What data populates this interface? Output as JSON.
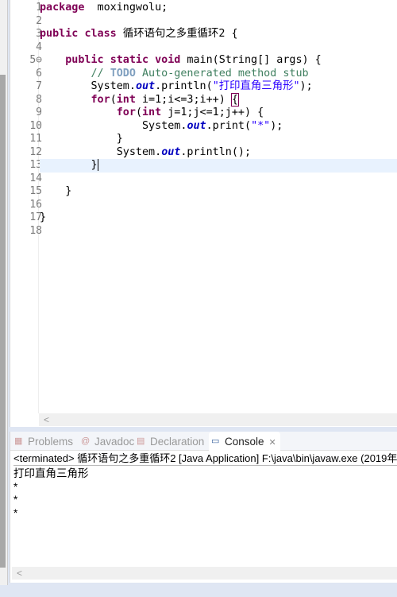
{
  "editor": {
    "lines": [
      [
        [
          "kw",
          "package"
        ],
        [
          "",
          "  moxingwolu;"
        ]
      ],
      [],
      [
        [
          "kw",
          "public"
        ],
        [
          "",
          " "
        ],
        [
          "kw",
          "class"
        ],
        [
          "",
          " 循环语句之多重循环2 {"
        ]
      ],
      [],
      [
        [
          "",
          "    "
        ],
        [
          "kw",
          "public"
        ],
        [
          "",
          " "
        ],
        [
          "kw",
          "static"
        ],
        [
          "",
          " "
        ],
        [
          "kw",
          "void"
        ],
        [
          "",
          " main(String[] args) {"
        ]
      ],
      [
        [
          "",
          "        "
        ],
        [
          "cm",
          "// "
        ],
        [
          "todo",
          "TODO"
        ],
        [
          "cm",
          " Auto-generated method stub"
        ]
      ],
      [
        [
          "",
          "        System."
        ],
        [
          "fd",
          "out"
        ],
        [
          "",
          ".println("
        ],
        [
          "st",
          "\"打印直角三角形\""
        ],
        [
          "",
          ");"
        ]
      ],
      [
        [
          "",
          "        "
        ],
        [
          "kw",
          "for"
        ],
        [
          "",
          "("
        ],
        [
          "kw",
          "int"
        ],
        [
          "",
          " i=1;i<=3;i++) "
        ],
        [
          "br",
          "{"
        ]
      ],
      [
        [
          "",
          "            "
        ],
        [
          "kw",
          "for"
        ],
        [
          "",
          "("
        ],
        [
          "kw",
          "int"
        ],
        [
          "",
          " j=1;j<=1;j++) {"
        ]
      ],
      [
        [
          "",
          "                System."
        ],
        [
          "fd",
          "out"
        ],
        [
          "",
          ".print("
        ],
        [
          "st",
          "\"*\""
        ],
        [
          "",
          ");"
        ]
      ],
      [
        [
          "",
          "            }"
        ]
      ],
      [
        [
          "",
          "            System."
        ],
        [
          "fd",
          "out"
        ],
        [
          "",
          ".println();"
        ]
      ],
      [
        [
          "caret",
          "        }"
        ]
      ],
      [],
      [
        [
          "",
          "    }"
        ]
      ],
      [],
      [
        [
          "",
          "}"
        ]
      ],
      []
    ],
    "current_line": 13,
    "scroll_left": "<"
  },
  "panel": {
    "tabs": [
      {
        "label": "Problems",
        "icon": "problems-icon",
        "active": false
      },
      {
        "label": "Javadoc",
        "icon": "at-icon",
        "active": false
      },
      {
        "label": "Declaration",
        "icon": "declaration-icon",
        "active": false
      },
      {
        "label": "Console",
        "icon": "console-icon",
        "active": true
      }
    ],
    "close_glyph": "✕",
    "terminated": "<terminated> 循环语句之多重循环2 [Java Application] F:\\java\\bin\\javaw.exe (2019年",
    "output": [
      "打印直角三角形",
      "*",
      "*",
      "*"
    ],
    "scroll_left": "<"
  }
}
